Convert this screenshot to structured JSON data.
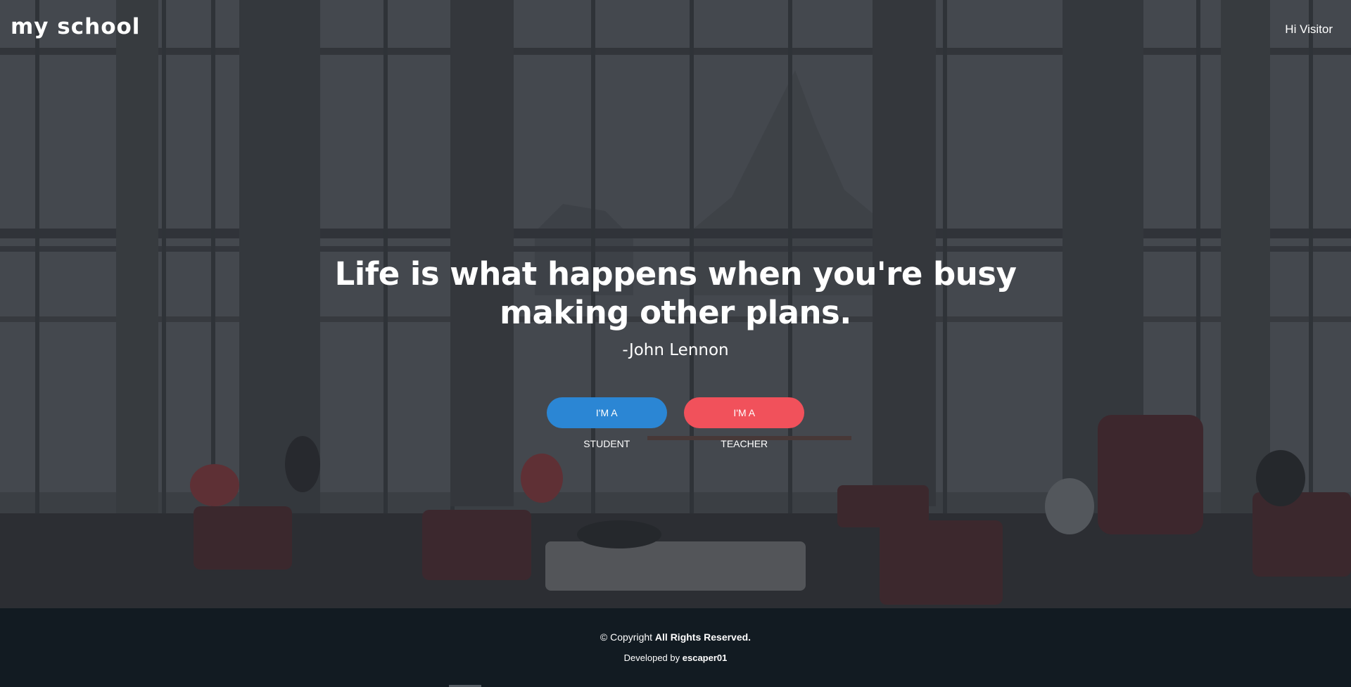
{
  "header": {
    "brand": "my school",
    "greeting": "Hi Visitor"
  },
  "hero": {
    "quote": "Life is what happens when you're busy making other plans.",
    "author": "-John Lennon",
    "background_description": "",
    "buttons": {
      "student_label": "I'M A STUDENT",
      "teacher_label": "I'M A TEACHER"
    }
  },
  "footer": {
    "copyright_prefix": "© Copyright",
    "copyright_rights": "All Rights Reserved.",
    "developed_prefix": "Developed by",
    "developer": "escaper01"
  },
  "colors": {
    "student_button": "#2b86d4",
    "teacher_button": "#f1515b",
    "footer_background": "#121b22",
    "text": "#ffffff"
  }
}
